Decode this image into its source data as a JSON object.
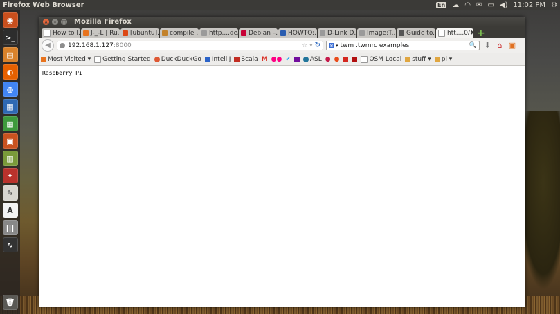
{
  "panel": {
    "app_title": "Firefox Web Browser",
    "keyboard_layout": "En",
    "clock": "11:02 PM"
  },
  "launcher": {
    "items": [
      "dash",
      "terminal",
      "files",
      "firefox",
      "chromium",
      "writer",
      "calc",
      "impress",
      "archive",
      "settings",
      "text-editor",
      "updates",
      "mixer",
      "system-monitor"
    ]
  },
  "window": {
    "title": "Mozilla Firefox"
  },
  "tabs": [
    {
      "label": "How to I...",
      "color": "#ffffff"
    },
    {
      "label": "J-_-L | Ru...",
      "color": "#e8731d"
    },
    {
      "label": "[ubuntu]...",
      "color": "#dd4814"
    },
    {
      "label": "compile ...",
      "color": "#c3822a"
    },
    {
      "label": "http....de/",
      "color": "#9a9a9a"
    },
    {
      "label": "Debian –...",
      "color": "#c70036"
    },
    {
      "label": "HOWTO:...",
      "color": "#2a5db0"
    },
    {
      "label": "D-Link D...",
      "color": "#9a9a9a"
    },
    {
      "label": "Image:T...",
      "color": "#9a9a9a"
    },
    {
      "label": "Guide to...",
      "color": "#555555"
    },
    {
      "label": "htt....0/",
      "color": "#ffffff",
      "active": true
    }
  ],
  "navbar": {
    "url_host": "192.168.1.127",
    "url_port": ":8000",
    "search_query": "twm .twmrc examples"
  },
  "bookmarks": [
    {
      "label": "Most Visited ▾",
      "color": "#e8731d"
    },
    {
      "label": "Getting Started",
      "color": "#ffffff"
    },
    {
      "label": "DuckDuckGo",
      "color": "#de5833"
    },
    {
      "label": "IntelliJ",
      "color": "#2b63c8"
    },
    {
      "label": "Scala",
      "color": "#c22d22"
    },
    {
      "label": "",
      "color": "#d93025"
    },
    {
      "label": "",
      "color": "#ff0084"
    },
    {
      "label": "",
      "color": "#1da1f2"
    },
    {
      "label": "",
      "color": "#720e9e"
    },
    {
      "label": "ASL",
      "color": "#21759b"
    },
    {
      "label": "",
      "color": "#c51a4a"
    },
    {
      "label": "",
      "color": "#e94b1a"
    },
    {
      "label": "",
      "color": "#d4271f"
    },
    {
      "label": "",
      "color": "#b10f0f"
    },
    {
      "label": "OSM Local",
      "color": "#ffffff"
    },
    {
      "label": "stuff ▾",
      "color": "#e0a640"
    },
    {
      "label": "pi ▾",
      "color": "#e0a640"
    }
  ],
  "page": {
    "text": "Raspberry Pi"
  }
}
